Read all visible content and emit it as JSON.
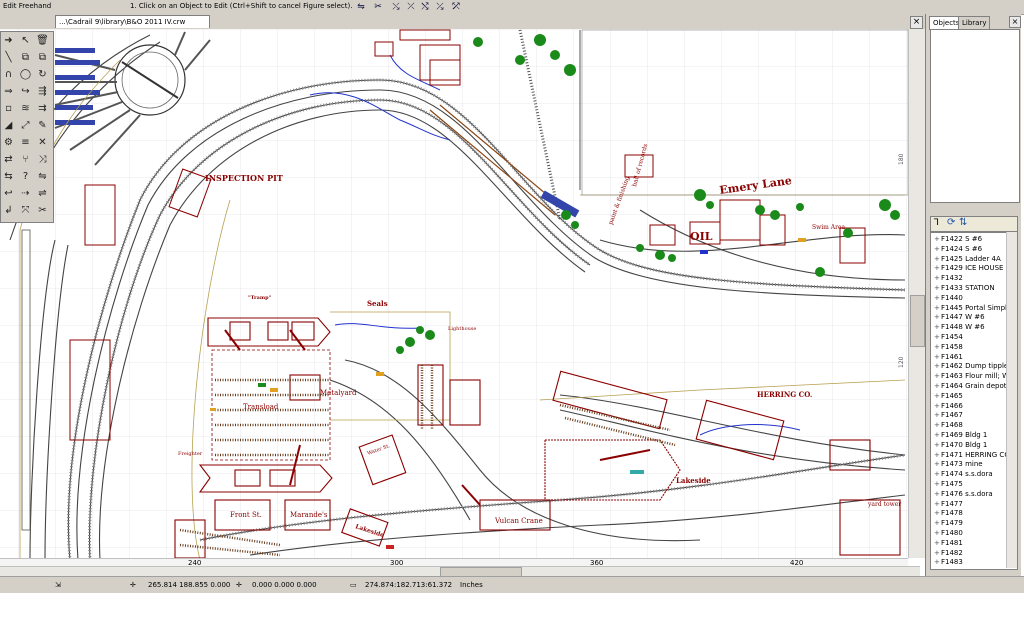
{
  "toolbar": {
    "mode": "Edit Freehand",
    "hint": "1. Click on an Object to Edit (Ctrl+Shift to cancel Figure select).",
    "buttons": [
      "⇋",
      "✂",
      "⤯",
      "⤫",
      "⤭",
      "⤰",
      "⤱"
    ]
  },
  "document": {
    "tab_title": "...\\Cadrail 9\\library\\B&O 2011 IV.crw"
  },
  "right_panel": {
    "tabs": [
      "Objects",
      "Library"
    ],
    "list": [
      "F1422 S #6",
      "F1424 S #6",
      "F1425 Ladder 4A",
      "F1429 ICE HOUSE &",
      "F1432",
      "F1433 STATION",
      "F1440",
      "F1445 Portal Simple",
      "F1447 W #6",
      "F1448 W #6",
      "F1454",
      "F1458",
      "F1461",
      "F1462 Dump tipple; I",
      "F1463 Flour mill; Wall",
      "F1464 Grain depot; B",
      "F1465",
      "F1466",
      "F1467",
      "F1468",
      "F1469 Bldg 1",
      "F1470 Bldg 1",
      "F1471 HERRING CO",
      "F1473 mine",
      "F1474 s.s.dora",
      "F1475",
      "F1476 s.s.dora",
      "F1477",
      "F1478",
      "F1479",
      "F1480",
      "F1481",
      "F1482",
      "F1483"
    ]
  },
  "ruler": {
    "h_ticks": [
      "240",
      "300",
      "360",
      "420"
    ],
    "v_ticks": [
      "180",
      "120"
    ]
  },
  "map_labels": {
    "inspection_pit": "INSPECTION PIT",
    "emery_lane": "Emery Lane",
    "swim_area": "Swim Area",
    "seals": "Seals",
    "tramp": "\"Tramp\"",
    "lighthouse": "Lighthouse",
    "transload": "Transload",
    "metalyard": "Metalyard",
    "herring_co": "HERRING CO.",
    "lakeside": "Lakeside",
    "lakeside2": "Lakeside",
    "vulcan_crane": "Vulcan Crane",
    "front_st": "Front St.",
    "marandes": "Marande's",
    "yard_tower": "yard tower",
    "freighter": "Freighter",
    "oil": "OIL",
    "hall": "hall of records",
    "paint": "paint & finishing",
    "water_st": "Water St."
  },
  "status": {
    "coords1": "265.814  188.855  0.000",
    "coords2": "0.000  0.000  0.000",
    "coords3": "274.874:182.713:61.372",
    "units": "Inches"
  }
}
